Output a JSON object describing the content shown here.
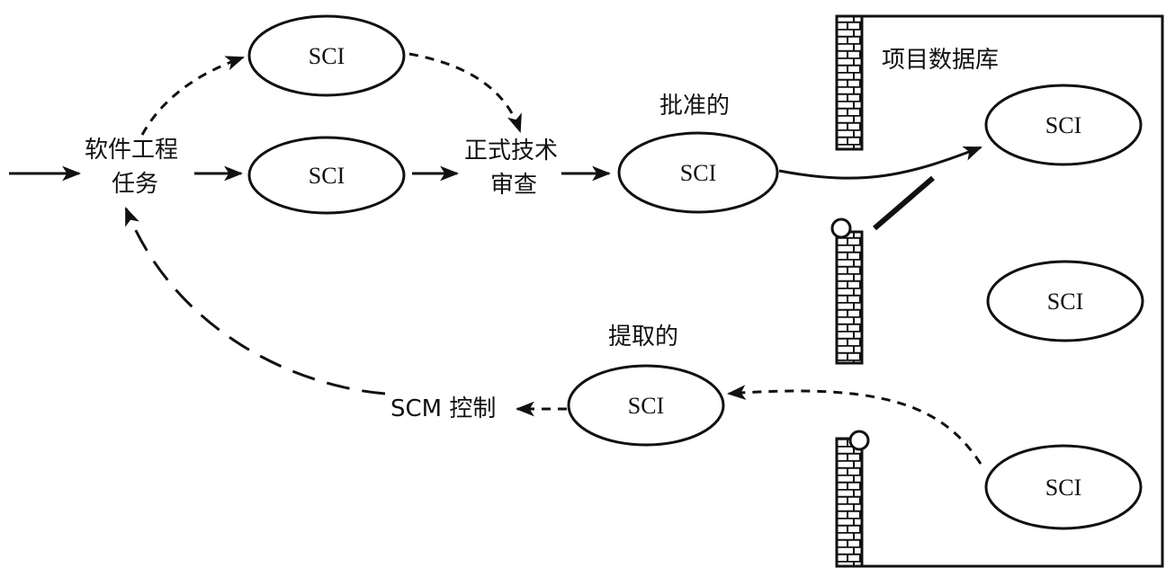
{
  "labels": {
    "task_line1": "软件工程",
    "task_line2": "任务",
    "ftr_line1": "正式技术",
    "ftr_line2": "审查",
    "approved": "批准的",
    "extracted": "提取的",
    "scm_control": "SCM 控制",
    "project_db": "项目数据库"
  },
  "nodes": {
    "sci_top": "SCI",
    "sci_mid": "SCI",
    "sci_approved": "SCI",
    "sci_db_1": "SCI",
    "sci_db_2": "SCI",
    "sci_db_3": "SCI",
    "sci_extracted": "SCI"
  },
  "colors": {
    "ink": "#111111",
    "background": "#ffffff"
  }
}
